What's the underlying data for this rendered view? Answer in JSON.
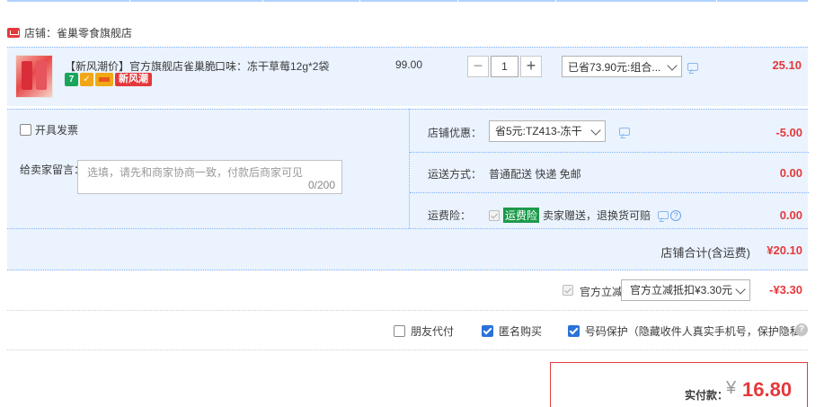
{
  "shop": {
    "icon": "shop-icon",
    "label": "店铺：雀巢零食旗舰店"
  },
  "item": {
    "title": "【新风潮价】官方旗舰店雀巢脆...",
    "sku": "口味：冻干草莓12g*2袋",
    "badges": [
      "7",
      "seven-day-return-icon",
      "shield-icon",
      "card-icon"
    ],
    "new_badge": "新风潮",
    "unit_price": "99.00",
    "quantity": "1",
    "qty_minus": "−",
    "qty_plus": "+",
    "promo": "已省73.90元:组合...",
    "subtotal": "25.10"
  },
  "invoice": {
    "label": "开具发票"
  },
  "note": {
    "label": "给卖家留言：",
    "placeholder": "选填，请先和商家协商一致，付款后商家可见",
    "counter": "0/200"
  },
  "discount": {
    "label": "店铺优惠：",
    "selected": "省5元:TZ413-冻干",
    "amount": "-5.00"
  },
  "shipping": {
    "label": "运送方式：",
    "value": "普通配送 快递 免邮",
    "amount": "0.00"
  },
  "insurance": {
    "label": "运费险：",
    "tag": "运费险",
    "text": "卖家赠送，退换货可赔",
    "help": "?",
    "amount": "0.00"
  },
  "shop_total": {
    "label": "店铺合计(含运费)",
    "value": "¥20.10"
  },
  "official": {
    "label": "官方立减",
    "selected": "官方立减抵扣¥3.30元",
    "amount": "-¥3.30"
  },
  "options": {
    "friend_pay": "朋友代付",
    "anonymous": "匿名购买",
    "number_protect": "号码保护（隐藏收件人真实手机号，保护隐私）",
    "help": "?"
  },
  "payment": {
    "label": "实付款：",
    "currency": "¥",
    "amount": "16.80"
  },
  "colors": {
    "accent_red": "#e4393c",
    "panel_blue": "#eaf3fe",
    "check_blue": "#2a72d9"
  }
}
